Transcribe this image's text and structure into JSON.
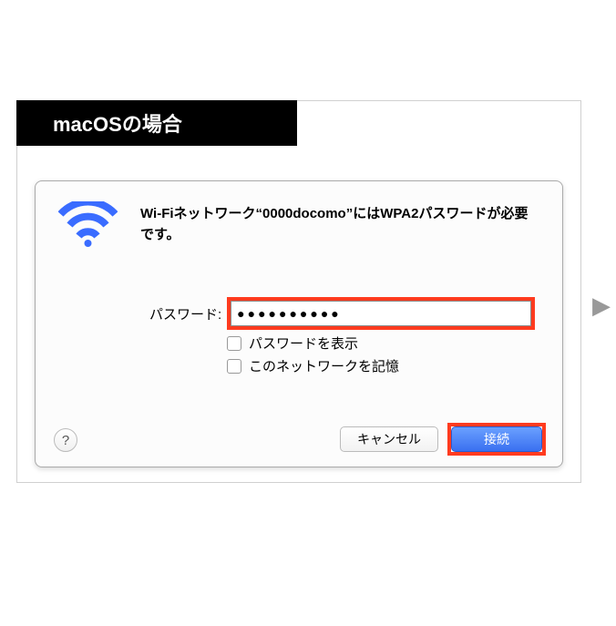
{
  "banner": {
    "title": "macOSの場合"
  },
  "dialog": {
    "message": "Wi-Fiネットワーク“0000docomo”にはWPA2パスワードが必要です。",
    "password_label": "パスワード:",
    "password_value": "●●●●●●●●●●",
    "show_password_label": "パスワードを表示",
    "remember_network_label": "このネットワークを記憶",
    "help_label": "?",
    "cancel_label": "キャンセル",
    "connect_label": "接続"
  },
  "nav": {
    "next_arrow": "▶"
  },
  "colors": {
    "highlight": "#ff3b1f",
    "wifi_blue": "#3a6cff",
    "primary_button": "#3a70f0"
  }
}
